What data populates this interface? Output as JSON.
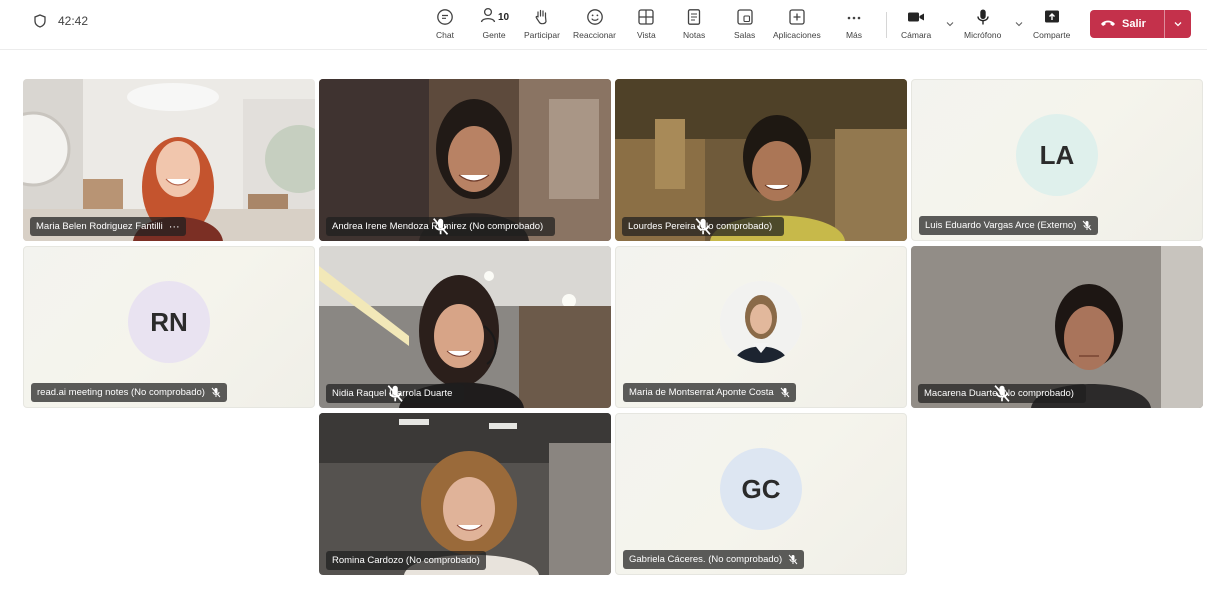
{
  "toolbar": {
    "timer": "42:42",
    "people_count": "10",
    "items": [
      {
        "label": "Chat"
      },
      {
        "label": "Gente"
      },
      {
        "label": "Participar"
      },
      {
        "label": "Reaccionar"
      },
      {
        "label": "Vista"
      },
      {
        "label": "Notas"
      },
      {
        "label": "Salas"
      },
      {
        "label": "Aplicaciones"
      },
      {
        "label": "Más"
      },
      {
        "label": "Cámara"
      },
      {
        "label": "Micrófono"
      },
      {
        "label": "Comparte"
      }
    ],
    "leave_label": "Salir"
  },
  "participants": [
    {
      "name": "Maria Belen Rodriguez Fantilli",
      "more": "···",
      "type": "video"
    },
    {
      "name": "Andrea Irene Mendoza Ramirez (No comprobado)",
      "type": "video"
    },
    {
      "name": "Lourdes Pereira (No comprobado)",
      "type": "video"
    },
    {
      "name": "Luis Eduardo Vargas Arce (Externo)",
      "initials": "LA",
      "type": "avatar"
    },
    {
      "name": "read.ai meeting notes (No comprobado)",
      "initials": "RN",
      "type": "avatar"
    },
    {
      "name": "Nidia Raquel Ibarrola Duarte",
      "type": "video"
    },
    {
      "name": "Maria de Montserrat Aponte Costa",
      "type": "photo"
    },
    {
      "name": "Macarena Duarte (No comprobado)",
      "type": "video"
    },
    {
      "name": "Romina Cardozo (No comprobado)",
      "type": "video"
    },
    {
      "name": "Gabriela Cáceres. (No comprobado)",
      "initials": "GC",
      "type": "avatar"
    }
  ],
  "colors": {
    "leave": "#c4314b",
    "avatar_la": "#dff0ec",
    "avatar_rn": "#e9e3f1",
    "avatar_gc": "#dde6f2"
  }
}
